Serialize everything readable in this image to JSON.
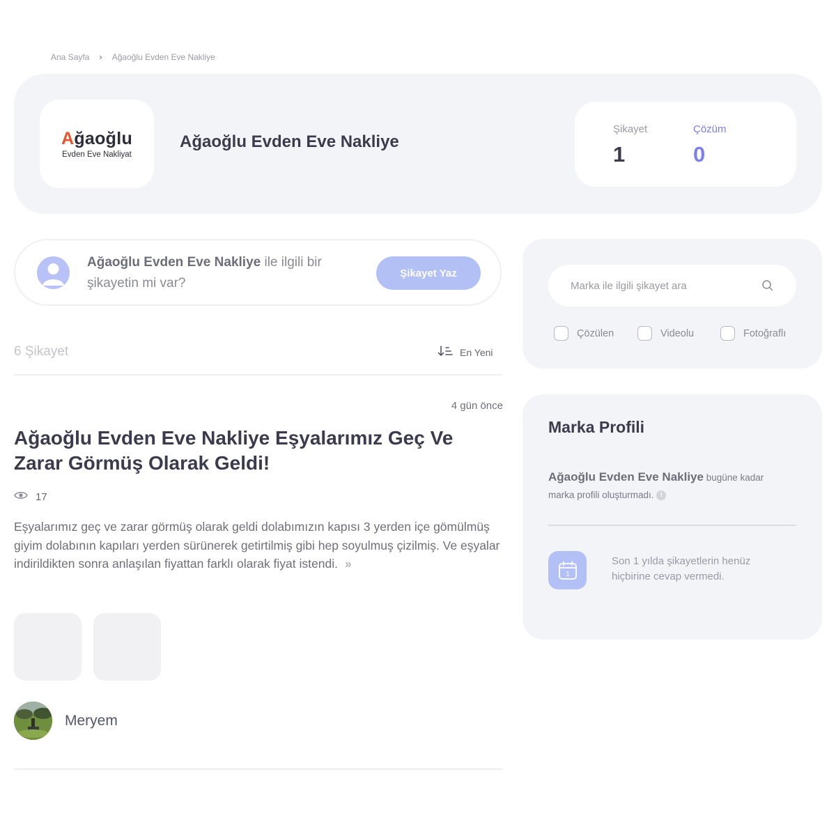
{
  "breadcrumb": {
    "home": "Ana Sayfa",
    "separator": "›",
    "current": "Ağaoğlu Evden Eve Nakliye"
  },
  "brand": {
    "logo_first": "A",
    "logo_rest": "ğaoğlu",
    "logo_sub": "Evden Eve Nakliyat",
    "name": "Ağaoğlu Evden Eve Nakliye"
  },
  "stats": {
    "complaints_label": "Şikayet",
    "complaints_value": "1",
    "solutions_label": "Çözüm",
    "solutions_value": "0"
  },
  "ask": {
    "brand": "Ağaoğlu Evden Eve Nakliye",
    "question": " ile ilgili bir şikayetin mi var?",
    "button": "Şikayet Yaz"
  },
  "list": {
    "count": "6 Şikayet",
    "sort_label": "En Yeni"
  },
  "complaint": {
    "time": "4 gün önce",
    "title": "Ağaoğlu Evden Eve Nakliye Eşyalarımız Geç Ve Zarar Görmüş Olarak Geldi!",
    "views": "17",
    "body": "Eşyalarımız geç ve zarar görmüş olarak geldi dolabımızın kapısı 3 yerden içe gömülmüş giyim dolabının kapıları yerden sürünerek getirtilmiş gibi hep soyulmuş çizilmiş. Ve eşyalar indirildikten sonra anlaşılan fiyattan farklı olarak fiyat istendi.",
    "more_icon": "»",
    "user": "Meryem"
  },
  "search": {
    "placeholder": "Marka ile ilgili şikayet ara"
  },
  "filters": [
    "Çözülen",
    "Videolu",
    "Fotoğraflı"
  ],
  "profile": {
    "title": "Marka Profili",
    "brand": "Ağaoğlu Evden Eve Nakliye",
    "text": " bugüne kadar marka profili oluşturmadı.",
    "info_icon": "i",
    "calendar_day": "1",
    "response_text": "Son 1 yılda şikayetlerin henüz hiçbirine cevap vermedi."
  },
  "colors": {
    "accent": "#7b7ff0",
    "button": "#b3c0f6",
    "logo_accent": "#e8542c",
    "card_bg": "#f3f4f8"
  }
}
